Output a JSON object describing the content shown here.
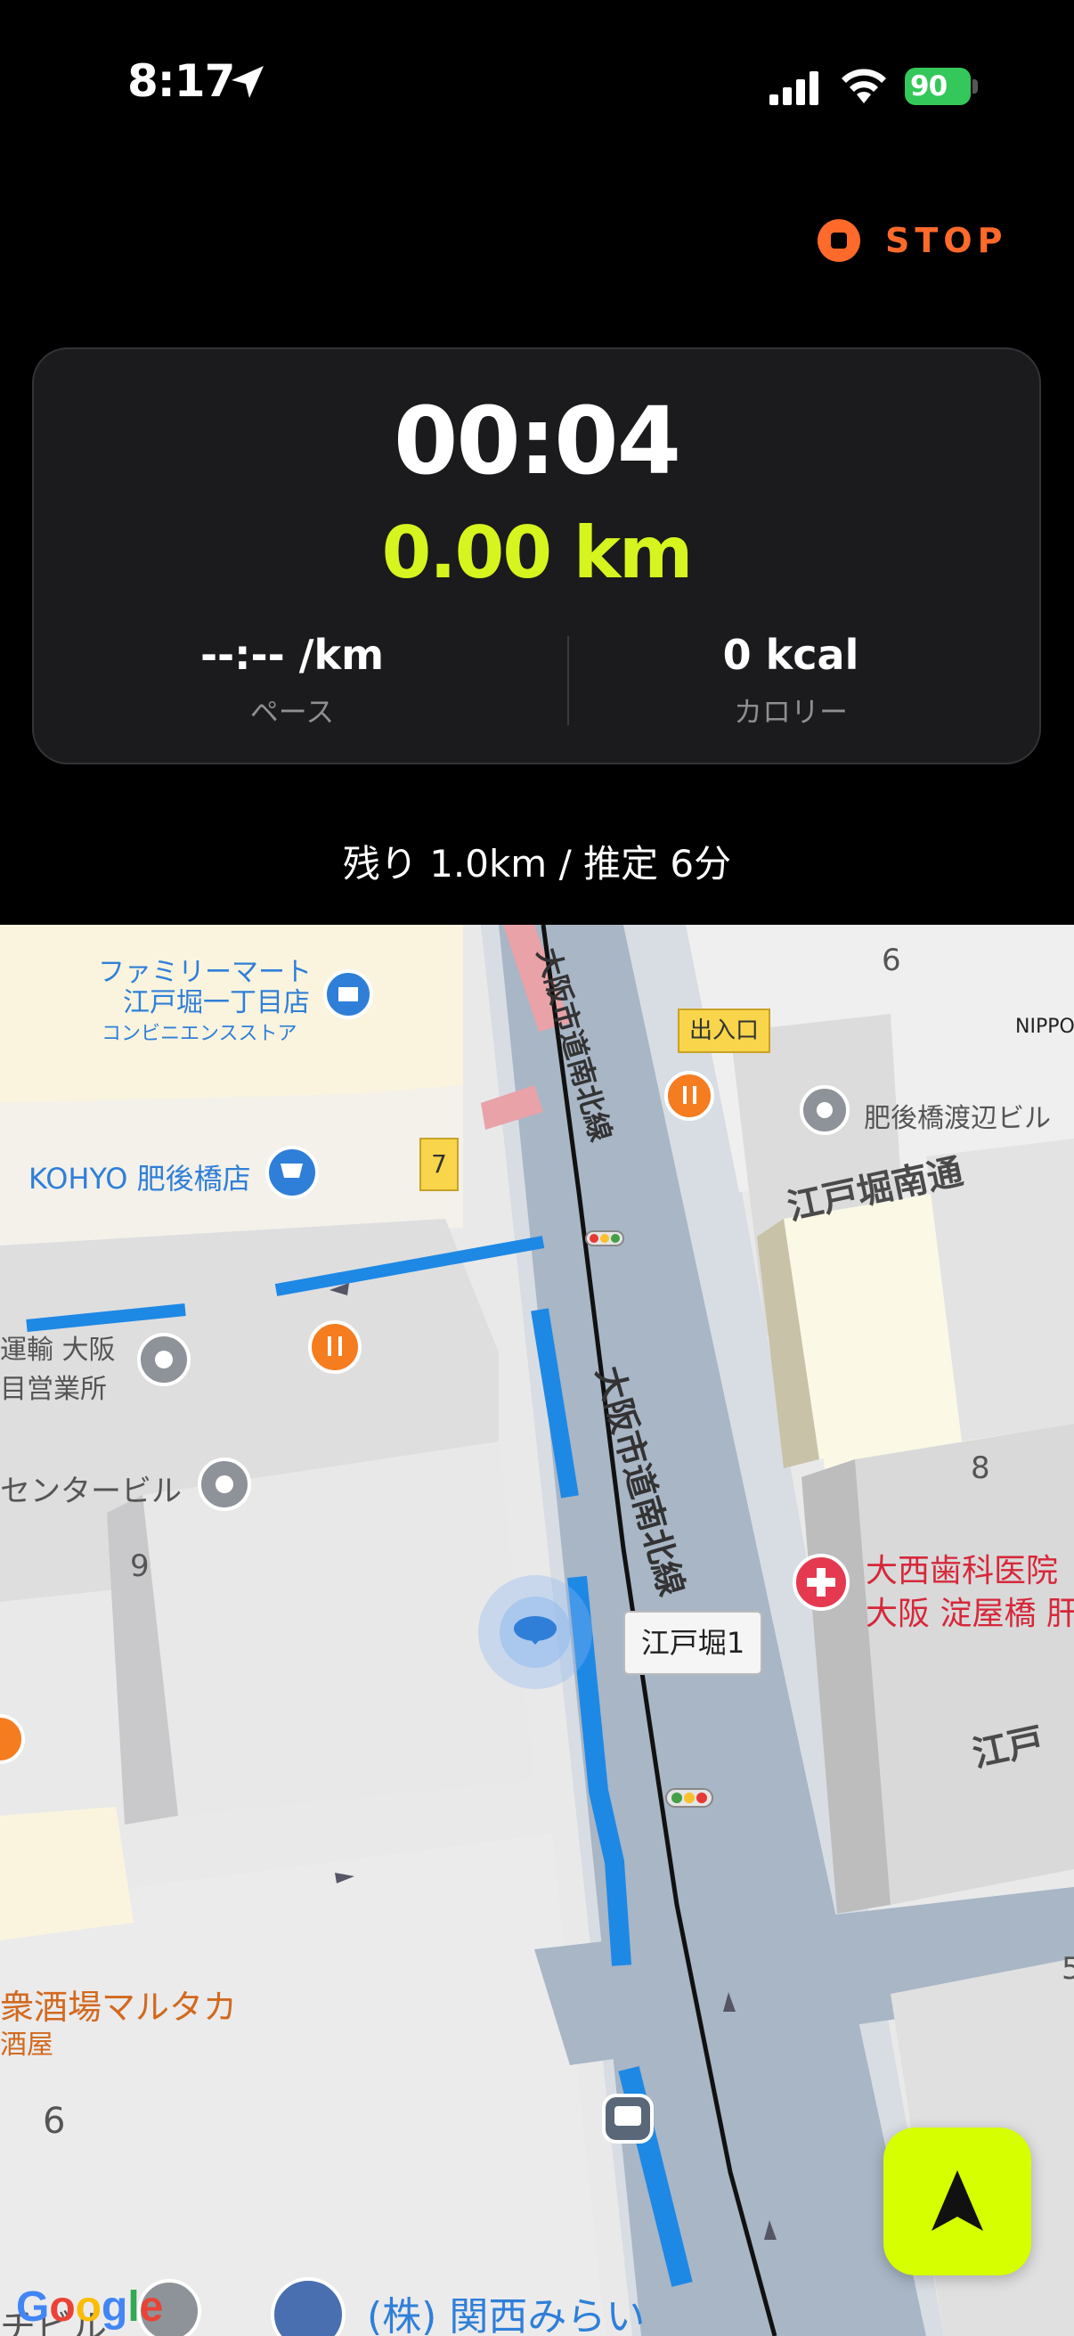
{
  "status_bar": {
    "time": "8:17",
    "battery_percent": "90",
    "icons": [
      "location-arrow-icon",
      "signal-icon",
      "wifi-icon",
      "battery-icon"
    ]
  },
  "controls": {
    "stop_label": "STOP",
    "stop_color": "#ff6a2a"
  },
  "stats": {
    "elapsed_time": "00:04",
    "distance": "0.00 km",
    "distance_color": "#d6f51e",
    "pace_value": "--:-- /km",
    "pace_label": "ペース",
    "calories_value": "0 kcal",
    "calories_label": "カロリー"
  },
  "route": {
    "remaining_text": "残り 1.0km / 推定 6分"
  },
  "map": {
    "labels": {
      "familymart_line1": "ファミリーマート",
      "familymart_line2": "江戸堀一丁目店",
      "familymart_category": "コンビニエンスストア",
      "kohyo": "KOHYO 肥後橋店",
      "unyu_line1": "運輸 大阪",
      "unyu_line2": "目営業所",
      "center_building": "センタービル",
      "izakaya_line1": "衆酒場マルタカ",
      "izakaya_line2": "酒屋",
      "road_north": "大阪市道南北線",
      "road_south": "大阪市道南北線",
      "intersection": "江戸堀1",
      "entrance": "出入口",
      "exit_number": "7",
      "higobashi_watanabe": "肥後橋渡辺ビル",
      "nippon": "NIPPO",
      "edobori_minami": "江戸堀南通",
      "edobori_partial": "江戸",
      "dental_line1": "大西歯科医院",
      "dental_line2": "大阪 淀屋橋 肝",
      "kansai_mirai": "(株) 関西みらい",
      "bottom_left": "チビル",
      "block_6_top": "6",
      "block_8": "8",
      "block_9": "9",
      "block_6_bottom": "6",
      "block_5": "5",
      "google": "Google"
    }
  },
  "nav_button": {
    "icon": "navigation-arrow-icon",
    "color": "#d6ff00"
  }
}
